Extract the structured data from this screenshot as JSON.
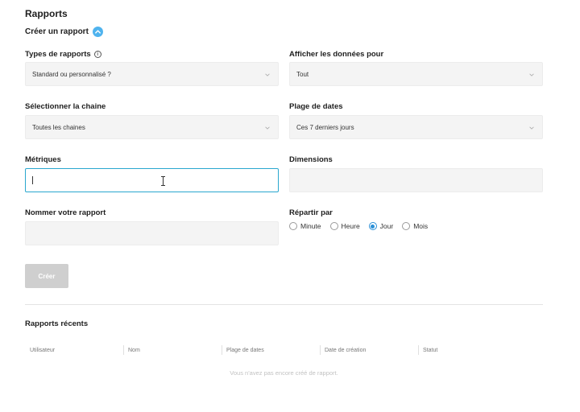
{
  "page": {
    "title": "Rapports"
  },
  "create_toggle": {
    "label": "Créer un rapport"
  },
  "form": {
    "report_types": {
      "label": "Types de rapports",
      "value": "Standard ou personnalisé ?"
    },
    "show_data_for": {
      "label": "Afficher les données pour",
      "value": "Tout"
    },
    "channel": {
      "label": "Sélectionner la chaine",
      "value": "Toutes les chaines"
    },
    "date_range": {
      "label": "Plage de dates",
      "value": "Ces 7 derniers jours"
    },
    "metrics": {
      "label": "Métriques",
      "value": ""
    },
    "dimensions": {
      "label": "Dimensions",
      "value": ""
    },
    "report_name": {
      "label": "Nommer votre rapport",
      "value": ""
    },
    "split_by": {
      "label": "Répartir par",
      "options": [
        "Minute",
        "Heure",
        "Jour",
        "Mois"
      ],
      "selected": "Jour"
    },
    "create_button": {
      "label": "Créer"
    }
  },
  "recent": {
    "title": "Rapports récents",
    "columns": [
      "Utilisateur",
      "Nom",
      "Plage de dates",
      "Date de création",
      "Statut"
    ],
    "empty_message": "Vous n'avez pas encore créé de rapport."
  },
  "colors": {
    "accent": "#2a8fd6",
    "focus_border": "#2aa7cf",
    "toggle_icon": "#4fb3ee",
    "button_disabled": "#cfcfcf"
  }
}
